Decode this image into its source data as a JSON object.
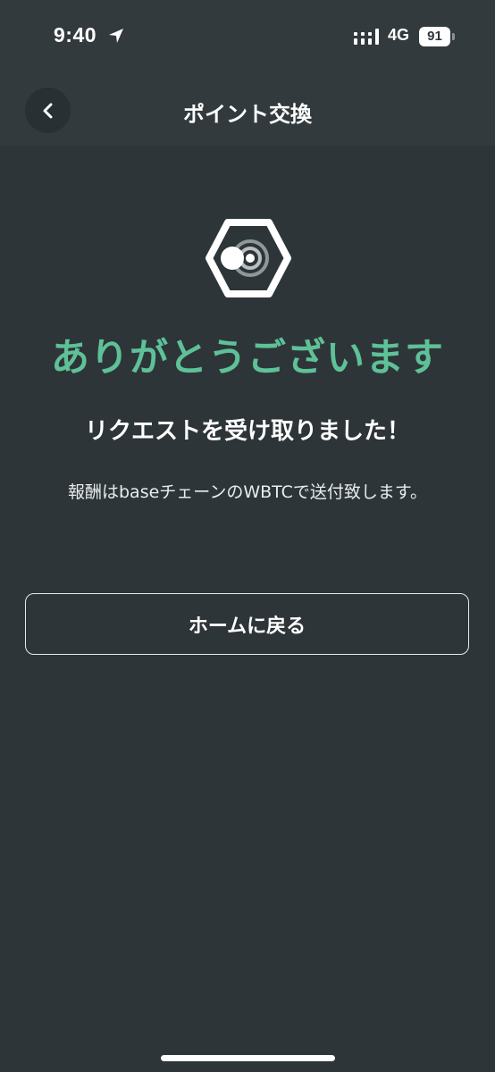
{
  "status_bar": {
    "time": "9:40",
    "network": "4G",
    "battery_level": "91",
    "icons": [
      "location-arrow-icon",
      "signal-icon",
      "battery-icon"
    ]
  },
  "nav": {
    "title": "ポイント交換",
    "back_icon": "chevron-left-icon"
  },
  "content": {
    "logo_icon": "hexagon-logo-icon",
    "heading": "ありがとうございます",
    "subheading": "リクエストを受け取りました！",
    "note": "報酬はbaseチェーンのWBTCで送付致します。",
    "home_button_label": "ホームに戻る"
  },
  "colors": {
    "background": "#2e3538",
    "header": "#323a3d",
    "accent": "#5ec198",
    "text": "#ffffff"
  }
}
